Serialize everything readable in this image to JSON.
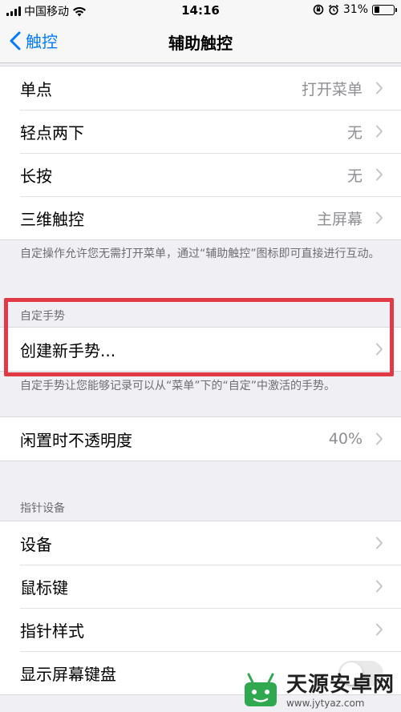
{
  "status_bar": {
    "carrier": "中国移动",
    "time": "14:16",
    "battery": "31%",
    "battery_level": 0.31
  },
  "nav": {
    "back_label": "触控",
    "title": "辅助触控"
  },
  "actions": [
    {
      "label": "单点",
      "value": "打开菜单"
    },
    {
      "label": "轻点两下",
      "value": "无"
    },
    {
      "label": "长按",
      "value": "无"
    },
    {
      "label": "三维触控",
      "value": "主屏幕"
    }
  ],
  "actions_footer": "自定操作允许您无需打开菜单，通过“辅助触控”图标即可直接进行互动。",
  "custom_gestures": {
    "header": "自定手势",
    "create_label": "创建新手势...",
    "footer": "自定手势让您能够记录可以从“菜单”下的“自定”中激活的手势。"
  },
  "opacity": {
    "label": "闲置时不透明度",
    "value": "40%"
  },
  "pointer": {
    "header": "指针设备",
    "items": [
      {
        "label": "设备"
      },
      {
        "label": "鼠标键"
      },
      {
        "label": "指针样式"
      },
      {
        "label": "显示屏幕键盘"
      }
    ]
  },
  "highlight_color": "#e03b45",
  "accent_color": "#007aff",
  "watermark": {
    "title": "天源安卓网",
    "url": "www.jytyaz.com"
  }
}
